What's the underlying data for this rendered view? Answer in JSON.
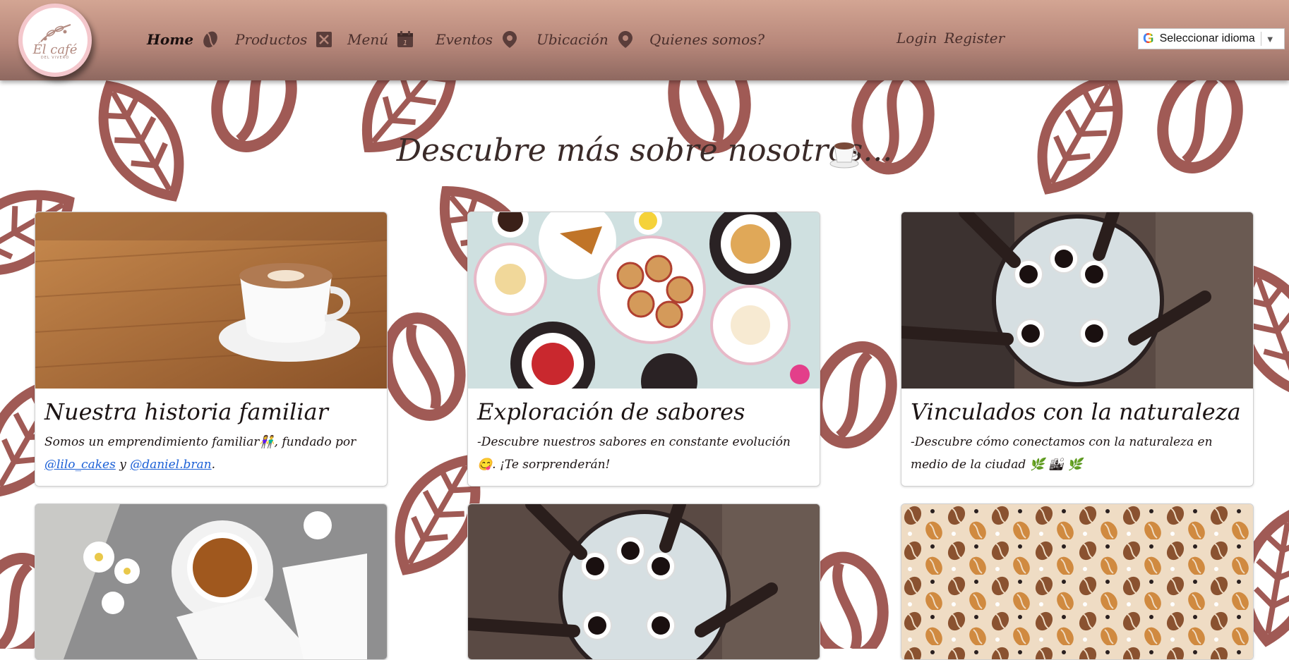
{
  "brand": {
    "name": "Él café",
    "tagline": "DEL VIVERO"
  },
  "nav": {
    "items": [
      {
        "label": "Home",
        "icon": "coffee-bean-icon",
        "active": true
      },
      {
        "label": "Productos",
        "icon": "utensils-icon"
      },
      {
        "label": "Menú",
        "icon": "calendar-icon"
      },
      {
        "label": "Eventos",
        "icon": "map-pin-icon"
      },
      {
        "label": "Ubicación",
        "icon": "map-pin-icon"
      },
      {
        "label": "Quienes somos?"
      }
    ],
    "login": "Login",
    "register": "Register"
  },
  "translate": {
    "g": "G",
    "label": "Seleccionar idioma",
    "arrow": "▼"
  },
  "section": {
    "title": "Descubre más sobre nosotros..."
  },
  "cards": [
    {
      "title": "Nuestra historia familiar",
      "text_prefix": "Somos un emprendimiento familiar👫, fundado por",
      "link1": "@lilo_cakes",
      "conj": "y",
      "link2": "@daniel.bran",
      "text_suffix": "."
    },
    {
      "title": "Exploración de sabores",
      "text": "-Descubre nuestros sabores en constante evolución 😋. ¡Te sorprenderán!"
    },
    {
      "title": "Vinculados con la naturaleza",
      "text": "-Descubre cómo conectamos con la naturaleza en medio de la ciudad 🌿 🏙 🌿"
    }
  ],
  "colors": {
    "header_top": "#d3a593",
    "header_bottom": "#8e6860",
    "bean": "#a05a55",
    "link": "#1a5fd6"
  }
}
